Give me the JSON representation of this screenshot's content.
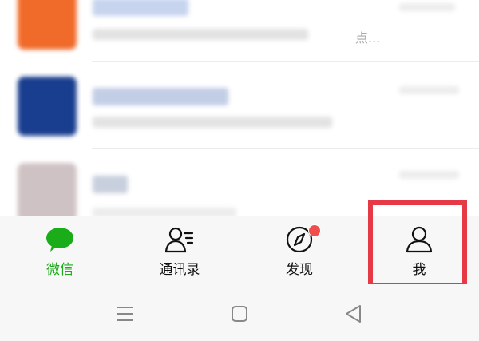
{
  "chat_list": {
    "items": [
      {
        "name": "",
        "preview": "",
        "time": "",
        "more_text": "点..."
      },
      {
        "name": "",
        "preview": "",
        "time": ""
      },
      {
        "name": "",
        "preview": "",
        "time": ""
      }
    ]
  },
  "tabbar": {
    "tabs": [
      {
        "label": "微信",
        "icon": "chat-bubble-icon",
        "active": true
      },
      {
        "label": "通讯录",
        "icon": "contacts-icon",
        "active": false
      },
      {
        "label": "发现",
        "icon": "compass-icon",
        "active": false,
        "badge": "red-dot"
      },
      {
        "label": "我",
        "icon": "person-icon",
        "active": false
      }
    ]
  },
  "system_nav": {
    "buttons": [
      "menu-icon",
      "home-icon",
      "back-icon"
    ]
  },
  "colors": {
    "active": "#1aad19",
    "badge": "#f24d4d",
    "highlight": "#e63946",
    "link_name": "#1f4fa3"
  }
}
